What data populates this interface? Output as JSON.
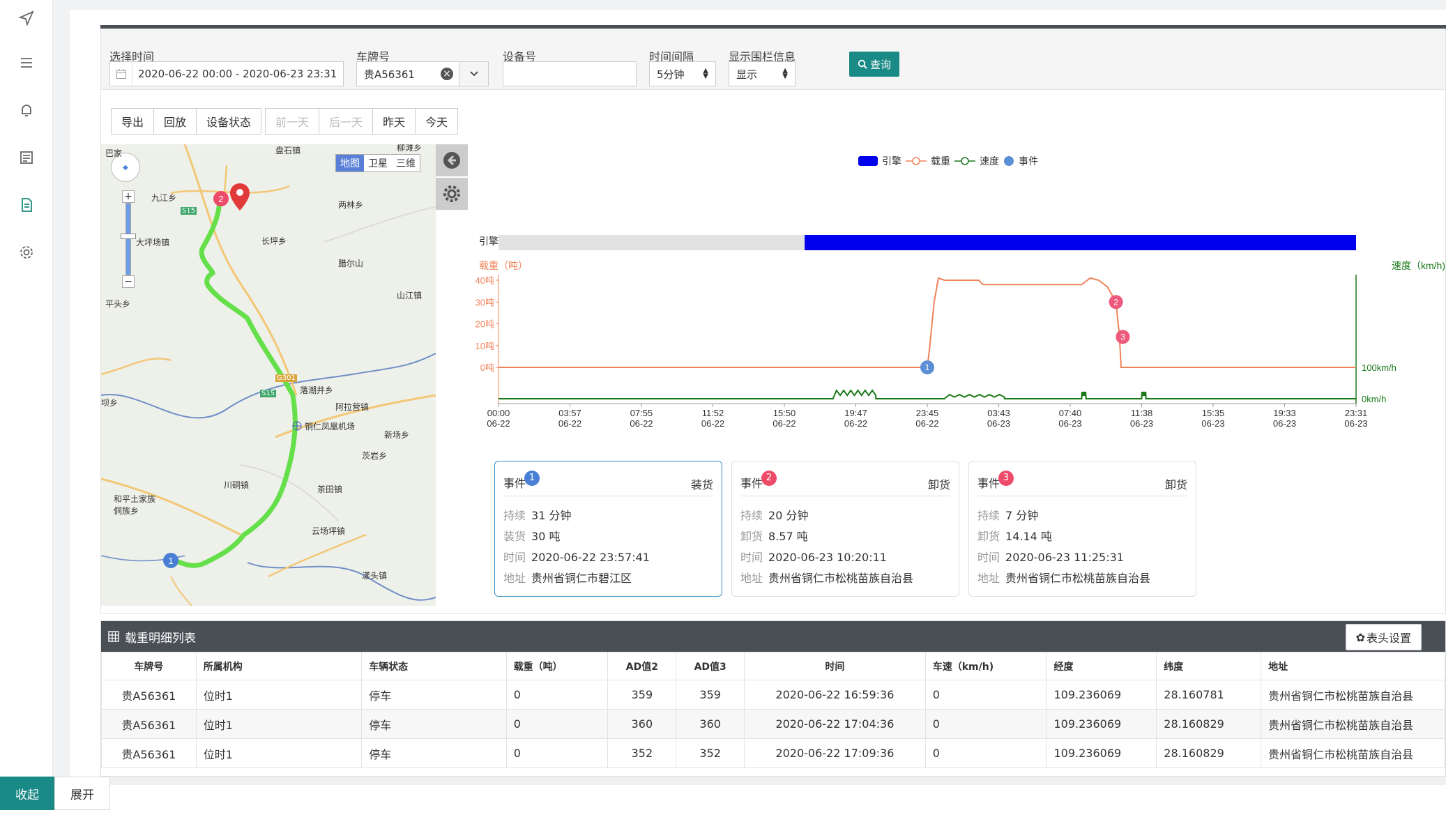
{
  "filters": {
    "time_label": "选择时间",
    "time_value": "2020-06-22 00:00 - 2020-06-23 23:31",
    "plate_label": "车牌号",
    "plate_value": "贵A56361",
    "device_label": "设备号",
    "device_value": "",
    "interval_label": "时间间隔",
    "interval_value": "5分钟",
    "fence_label": "显示围栏信息",
    "fence_value": "显示",
    "query_label": "查询"
  },
  "toolbar": {
    "export": "导出",
    "playback": "回放",
    "device_status": "设备状态",
    "prev_day": "前一天",
    "next_day": "后一天",
    "yesterday": "昨天",
    "today": "今天"
  },
  "map": {
    "types": [
      "地图",
      "卫星",
      "三维"
    ],
    "labels": [
      "巴家",
      "盘石镇",
      "柳滩乡",
      "九江乡",
      "两林乡",
      "长坪乡",
      "大坪场镇",
      "腊尔山",
      "平头乡",
      "山江镇",
      "落潮井乡",
      "阿拉营镇",
      "坝乡",
      "铜仁凤凰机场",
      "新场乡",
      "茨岩乡",
      "川硐镇",
      "茶田镇",
      "和平土家族侗族乡",
      "云场坪镇",
      "漾头镇",
      "S15",
      "S15",
      "G301"
    ],
    "markers": [
      "1",
      "2"
    ]
  },
  "chart_data": {
    "type": "line",
    "legend": [
      "引擎",
      "载重",
      "速度",
      "事件"
    ],
    "engine_label": "引擎",
    "left_axis_label": "载重（吨）",
    "right_axis_label": "速度（km/h)",
    "y_ticks": [
      "40吨",
      "30吨",
      "20吨",
      "10吨",
      "0吨"
    ],
    "right_ticks": [
      "100km/h",
      "0km/h"
    ],
    "x_ticks": [
      {
        "t": "00:00",
        "d": "06-22"
      },
      {
        "t": "03:57",
        "d": "06-22"
      },
      {
        "t": "07:55",
        "d": "06-22"
      },
      {
        "t": "11:52",
        "d": "06-22"
      },
      {
        "t": "15:50",
        "d": "06-22"
      },
      {
        "t": "19:47",
        "d": "06-22"
      },
      {
        "t": "23:45",
        "d": "06-22"
      },
      {
        "t": "03:43",
        "d": "06-23"
      },
      {
        "t": "07:40",
        "d": "06-23"
      },
      {
        "t": "11:38",
        "d": "06-23"
      },
      {
        "t": "15:35",
        "d": "06-23"
      },
      {
        "t": "19:33",
        "d": "06-23"
      },
      {
        "t": "23:31",
        "d": "06-23"
      }
    ],
    "ylim": [
      0,
      40
    ],
    "engine_on_fraction_start": 0.357,
    "load_series": {
      "name": "载重",
      "x_fraction": [
        0,
        0.5,
        0.503,
        0.508,
        0.513,
        0.52,
        0.56,
        0.565,
        0.57,
        0.6,
        0.68,
        0.69,
        0.7,
        0.71,
        0.72,
        0.722,
        0.724,
        0.726,
        1
      ],
      "values": [
        0,
        0,
        10,
        30,
        41,
        40,
        40,
        38,
        38,
        38,
        38,
        41,
        40,
        37,
        30,
        22,
        15,
        0,
        0
      ]
    },
    "speed_color": "#1a7a1a",
    "load_color": "#f0825a",
    "engine_color": "#0000ee",
    "event_colors": [
      "#5b8fd6",
      "#ee5a7c",
      "#ee5a7c"
    ],
    "events": [
      {
        "id": "1",
        "x_fraction": 0.5,
        "value": 0
      },
      {
        "id": "2",
        "x_fraction": 0.72,
        "value": 30
      },
      {
        "id": "3",
        "x_fraction": 0.728,
        "value": 14
      }
    ]
  },
  "events": [
    {
      "id": "1",
      "title": "事件",
      "type": "装货",
      "duration_k": "持续",
      "duration": "31 分钟",
      "load_k": "装货",
      "load": "30 吨",
      "time_k": "时间",
      "time": "2020-06-22 23:57:41",
      "addr_k": "地址",
      "addr": "贵州省铜仁市碧江区"
    },
    {
      "id": "2",
      "title": "事件",
      "type": "卸货",
      "duration_k": "持续",
      "duration": "20 分钟",
      "load_k": "卸货",
      "load": "8.57 吨",
      "time_k": "时间",
      "time": "2020-06-23 10:20:11",
      "addr_k": "地址",
      "addr": "贵州省铜仁市松桃苗族自治县"
    },
    {
      "id": "3",
      "title": "事件",
      "type": "卸货",
      "duration_k": "持续",
      "duration": "7 分钟",
      "load_k": "卸货",
      "load": "14.14 吨",
      "time_k": "时间",
      "time": "2020-06-23 11:25:31",
      "addr_k": "地址",
      "addr": "贵州省铜仁市松桃苗族自治县"
    }
  ],
  "table": {
    "title": "载重明细列表",
    "col_settings": "表头设置",
    "headers": [
      "车牌号",
      "所属机构",
      "车辆状态",
      "载重（吨）",
      "AD值2",
      "AD值3",
      "时间",
      "车速（km/h)",
      "经度",
      "纬度",
      "地址"
    ],
    "rows": [
      [
        "贵A56361",
        "位时1",
        "停车",
        "0",
        "359",
        "359",
        "2020-06-22 16:59:36",
        "0",
        "109.236069",
        "28.160781",
        "贵州省铜仁市松桃苗族自治县"
      ],
      [
        "贵A56361",
        "位时1",
        "停车",
        "0",
        "360",
        "360",
        "2020-06-22 17:04:36",
        "0",
        "109.236069",
        "28.160829",
        "贵州省铜仁市松桃苗族自治县"
      ],
      [
        "贵A56361",
        "位时1",
        "停车",
        "0",
        "352",
        "352",
        "2020-06-22 17:09:36",
        "0",
        "109.236069",
        "28.160829",
        "贵州省铜仁市松桃苗族自治县"
      ]
    ]
  },
  "bottom": {
    "collapse": "收起",
    "expand": "展开"
  }
}
